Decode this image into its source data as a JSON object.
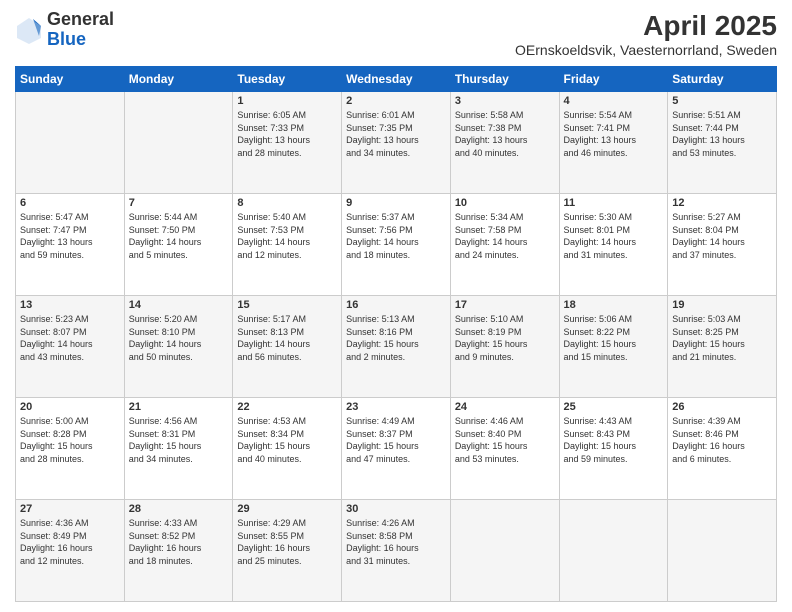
{
  "logo": {
    "general": "General",
    "blue": "Blue"
  },
  "header": {
    "title": "April 2025",
    "subtitle": "OErnskoeldsvik, Vaesternorrland, Sweden"
  },
  "weekdays": [
    "Sunday",
    "Monday",
    "Tuesday",
    "Wednesday",
    "Thursday",
    "Friday",
    "Saturday"
  ],
  "weeks": [
    [
      {
        "day": "",
        "info": ""
      },
      {
        "day": "",
        "info": ""
      },
      {
        "day": "1",
        "info": "Sunrise: 6:05 AM\nSunset: 7:33 PM\nDaylight: 13 hours\nand 28 minutes."
      },
      {
        "day": "2",
        "info": "Sunrise: 6:01 AM\nSunset: 7:35 PM\nDaylight: 13 hours\nand 34 minutes."
      },
      {
        "day": "3",
        "info": "Sunrise: 5:58 AM\nSunset: 7:38 PM\nDaylight: 13 hours\nand 40 minutes."
      },
      {
        "day": "4",
        "info": "Sunrise: 5:54 AM\nSunset: 7:41 PM\nDaylight: 13 hours\nand 46 minutes."
      },
      {
        "day": "5",
        "info": "Sunrise: 5:51 AM\nSunset: 7:44 PM\nDaylight: 13 hours\nand 53 minutes."
      }
    ],
    [
      {
        "day": "6",
        "info": "Sunrise: 5:47 AM\nSunset: 7:47 PM\nDaylight: 13 hours\nand 59 minutes."
      },
      {
        "day": "7",
        "info": "Sunrise: 5:44 AM\nSunset: 7:50 PM\nDaylight: 14 hours\nand 5 minutes."
      },
      {
        "day": "8",
        "info": "Sunrise: 5:40 AM\nSunset: 7:53 PM\nDaylight: 14 hours\nand 12 minutes."
      },
      {
        "day": "9",
        "info": "Sunrise: 5:37 AM\nSunset: 7:56 PM\nDaylight: 14 hours\nand 18 minutes."
      },
      {
        "day": "10",
        "info": "Sunrise: 5:34 AM\nSunset: 7:58 PM\nDaylight: 14 hours\nand 24 minutes."
      },
      {
        "day": "11",
        "info": "Sunrise: 5:30 AM\nSunset: 8:01 PM\nDaylight: 14 hours\nand 31 minutes."
      },
      {
        "day": "12",
        "info": "Sunrise: 5:27 AM\nSunset: 8:04 PM\nDaylight: 14 hours\nand 37 minutes."
      }
    ],
    [
      {
        "day": "13",
        "info": "Sunrise: 5:23 AM\nSunset: 8:07 PM\nDaylight: 14 hours\nand 43 minutes."
      },
      {
        "day": "14",
        "info": "Sunrise: 5:20 AM\nSunset: 8:10 PM\nDaylight: 14 hours\nand 50 minutes."
      },
      {
        "day": "15",
        "info": "Sunrise: 5:17 AM\nSunset: 8:13 PM\nDaylight: 14 hours\nand 56 minutes."
      },
      {
        "day": "16",
        "info": "Sunrise: 5:13 AM\nSunset: 8:16 PM\nDaylight: 15 hours\nand 2 minutes."
      },
      {
        "day": "17",
        "info": "Sunrise: 5:10 AM\nSunset: 8:19 PM\nDaylight: 15 hours\nand 9 minutes."
      },
      {
        "day": "18",
        "info": "Sunrise: 5:06 AM\nSunset: 8:22 PM\nDaylight: 15 hours\nand 15 minutes."
      },
      {
        "day": "19",
        "info": "Sunrise: 5:03 AM\nSunset: 8:25 PM\nDaylight: 15 hours\nand 21 minutes."
      }
    ],
    [
      {
        "day": "20",
        "info": "Sunrise: 5:00 AM\nSunset: 8:28 PM\nDaylight: 15 hours\nand 28 minutes."
      },
      {
        "day": "21",
        "info": "Sunrise: 4:56 AM\nSunset: 8:31 PM\nDaylight: 15 hours\nand 34 minutes."
      },
      {
        "day": "22",
        "info": "Sunrise: 4:53 AM\nSunset: 8:34 PM\nDaylight: 15 hours\nand 40 minutes."
      },
      {
        "day": "23",
        "info": "Sunrise: 4:49 AM\nSunset: 8:37 PM\nDaylight: 15 hours\nand 47 minutes."
      },
      {
        "day": "24",
        "info": "Sunrise: 4:46 AM\nSunset: 8:40 PM\nDaylight: 15 hours\nand 53 minutes."
      },
      {
        "day": "25",
        "info": "Sunrise: 4:43 AM\nSunset: 8:43 PM\nDaylight: 15 hours\nand 59 minutes."
      },
      {
        "day": "26",
        "info": "Sunrise: 4:39 AM\nSunset: 8:46 PM\nDaylight: 16 hours\nand 6 minutes."
      }
    ],
    [
      {
        "day": "27",
        "info": "Sunrise: 4:36 AM\nSunset: 8:49 PM\nDaylight: 16 hours\nand 12 minutes."
      },
      {
        "day": "28",
        "info": "Sunrise: 4:33 AM\nSunset: 8:52 PM\nDaylight: 16 hours\nand 18 minutes."
      },
      {
        "day": "29",
        "info": "Sunrise: 4:29 AM\nSunset: 8:55 PM\nDaylight: 16 hours\nand 25 minutes."
      },
      {
        "day": "30",
        "info": "Sunrise: 4:26 AM\nSunset: 8:58 PM\nDaylight: 16 hours\nand 31 minutes."
      },
      {
        "day": "",
        "info": ""
      },
      {
        "day": "",
        "info": ""
      },
      {
        "day": "",
        "info": ""
      }
    ]
  ]
}
